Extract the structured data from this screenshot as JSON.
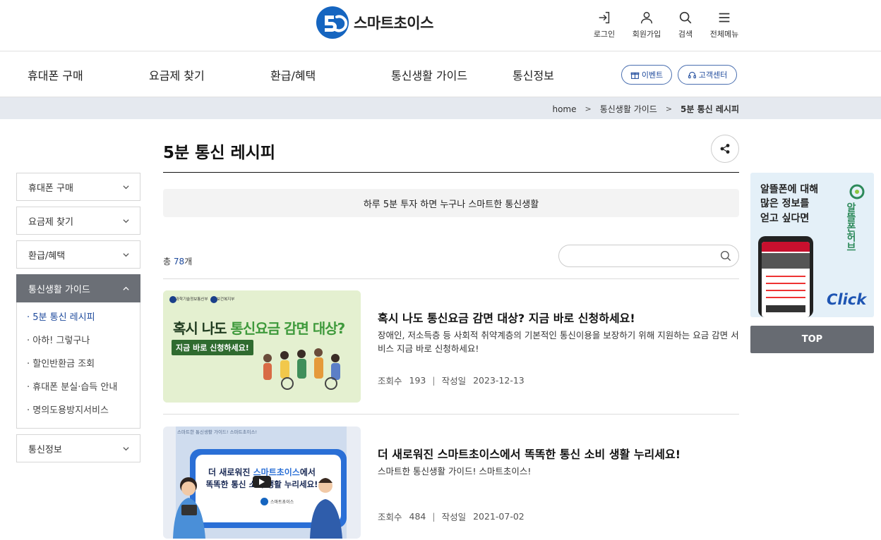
{
  "header": {
    "logo_text": "스마트초이스",
    "utility": [
      {
        "label": "로그인",
        "icon": "login-icon"
      },
      {
        "label": "회원가입",
        "icon": "user-icon"
      },
      {
        "label": "검색",
        "icon": "search-icon"
      },
      {
        "label": "전체메뉴",
        "icon": "menu-icon"
      }
    ]
  },
  "gnb": {
    "items": [
      "휴대폰 구매",
      "요금제 찾기",
      "환급/혜택",
      "통신생활 가이드",
      "통신정보"
    ],
    "event_label": "이벤트",
    "support_label": "고객센터"
  },
  "breadcrumb": {
    "home": "home",
    "parent": "통신생활 가이드",
    "current": "5분 통신 레시피"
  },
  "lnb": {
    "items": [
      "휴대폰 구매",
      "요금제 찾기",
      "환급/혜택",
      "통신생활 가이드",
      "통신정보"
    ],
    "sub": [
      "· 5분 통신 레시피",
      "· 아하! 그렇구나",
      "· 할인반환금 조회",
      "· 휴대폰 분실·습득 안내",
      "· 명의도용방지서비스"
    ]
  },
  "main": {
    "title": "5분 통신 레시피",
    "notice": "하루 5분 투자 하면 누구나 스마트한 통신생활",
    "total_prefix": "총 ",
    "total_count": "78",
    "total_suffix": "개",
    "search_placeholder": "",
    "meta_views_label": "조회수",
    "meta_date_label": "작성일",
    "posts": [
      {
        "title": "혹시 나도 통신요금 감면 대상? 지금 바로 신청하세요!",
        "desc": "장애인, 저소득층 등 사회적 취약계층의 기본적인 통신이용을 보장하기 위해 지원하는 요금 감면 서비스 지금 바로 신청하세요!",
        "views": "193",
        "date": "2023-12-13",
        "thumb": {
          "org1": "과학기술정보통신부",
          "org2": "보건복지부",
          "headline_a": "혹시 나도 ",
          "headline_b": "통신요금 감면 대상?",
          "sub": "지금 바로 신청하세요!"
        }
      },
      {
        "title": "더 새로워진 스마트초이스에서 똑똑한 통신 소비 생활 누리세요!",
        "desc": "스마트한 통신생활 가이드! 스마트초이스!",
        "views": "484",
        "date": "2021-07-02",
        "thumb": {
          "caption": "스마트한 통신생활 가이드! 스마트초이스!",
          "line1_a": "더 새로워진 ",
          "line1_b": "스마트초이스",
          "line1_c": "에서",
          "line2": "똑똑한 통신 소비 생활 누리세요!",
          "logo": "스마트초이스"
        }
      }
    ]
  },
  "banner": {
    "text_lines": [
      "알뜰폰에 대해",
      "많은 정보를",
      "얻고 싶다면"
    ],
    "brand": "알뜰폰허브",
    "click": "Click"
  },
  "top_label": "TOP",
  "colors": {
    "brand_blue": "#1e4a9c",
    "logo_blue": "#1565c0",
    "lnb_active": "#6b6f76"
  }
}
